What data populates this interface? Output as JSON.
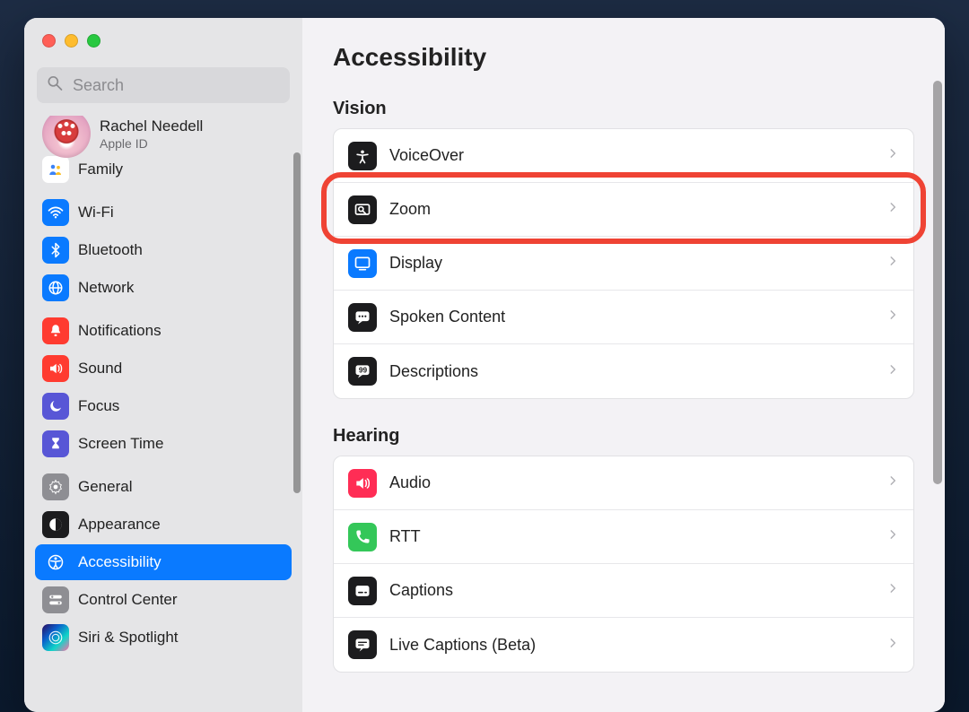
{
  "window_controls": {
    "close": "Close",
    "minimize": "Minimize",
    "zoom_window": "Zoom"
  },
  "search": {
    "placeholder": "Search"
  },
  "account": {
    "name": "Rachel Needell",
    "sub": "Apple ID"
  },
  "sidebar": {
    "groups": [
      {
        "items": [
          {
            "id": "family",
            "label": "Family",
            "icon": "family",
            "icon_bg": "#e6ecf8"
          }
        ]
      },
      {
        "items": [
          {
            "id": "wifi",
            "label": "Wi-Fi",
            "icon": "wifi",
            "icon_bg": "#0a7aff"
          },
          {
            "id": "bluetooth",
            "label": "Bluetooth",
            "icon": "bluetooth",
            "icon_bg": "#0a7aff"
          },
          {
            "id": "network",
            "label": "Network",
            "icon": "network",
            "icon_bg": "#0a7aff"
          }
        ]
      },
      {
        "items": [
          {
            "id": "notifications",
            "label": "Notifications",
            "icon": "bell",
            "icon_bg": "#ff3b30"
          },
          {
            "id": "sound",
            "label": "Sound",
            "icon": "speaker",
            "icon_bg": "#ff3b30"
          },
          {
            "id": "focus",
            "label": "Focus",
            "icon": "moon",
            "icon_bg": "#5856d6"
          },
          {
            "id": "screentime",
            "label": "Screen Time",
            "icon": "hourglass",
            "icon_bg": "#5856d6"
          }
        ]
      },
      {
        "items": [
          {
            "id": "general",
            "label": "General",
            "icon": "gear",
            "icon_bg": "#8e8e93"
          },
          {
            "id": "appearance",
            "label": "Appearance",
            "icon": "appearance",
            "icon_bg": "#1c1c1e"
          },
          {
            "id": "accessibility",
            "label": "Accessibility",
            "icon": "accessibility",
            "icon_bg": "#0a7aff",
            "selected": true
          },
          {
            "id": "controlcenter",
            "label": "Control Center",
            "icon": "switches",
            "icon_bg": "#8e8e93"
          },
          {
            "id": "siri",
            "label": "Siri & Spotlight",
            "icon": "siri",
            "icon_bg": "siri"
          }
        ]
      }
    ]
  },
  "main": {
    "title": "Accessibility",
    "sections": [
      {
        "title": "Vision",
        "rows": [
          {
            "id": "voiceover",
            "label": "VoiceOver",
            "icon": "voiceover",
            "icon_bg": "#1c1c1e"
          },
          {
            "id": "zoom",
            "label": "Zoom",
            "icon": "zoom",
            "icon_bg": "#1c1c1e",
            "highlighted": true
          },
          {
            "id": "display",
            "label": "Display",
            "icon": "display",
            "icon_bg": "#0a7aff"
          },
          {
            "id": "spoken",
            "label": "Spoken Content",
            "icon": "speech",
            "icon_bg": "#1c1c1e"
          },
          {
            "id": "descriptions",
            "label": "Descriptions",
            "icon": "quote",
            "icon_bg": "#1c1c1e"
          }
        ]
      },
      {
        "title": "Hearing",
        "rows": [
          {
            "id": "audio",
            "label": "Audio",
            "icon": "speaker",
            "icon_bg": "#ff2d55"
          },
          {
            "id": "rtt",
            "label": "RTT",
            "icon": "phone",
            "icon_bg": "#34c759"
          },
          {
            "id": "captions",
            "label": "Captions",
            "icon": "captions",
            "icon_bg": "#1c1c1e"
          },
          {
            "id": "livecaptions",
            "label": "Live Captions (Beta)",
            "icon": "livecaptions",
            "icon_bg": "#1c1c1e"
          }
        ]
      }
    ]
  }
}
